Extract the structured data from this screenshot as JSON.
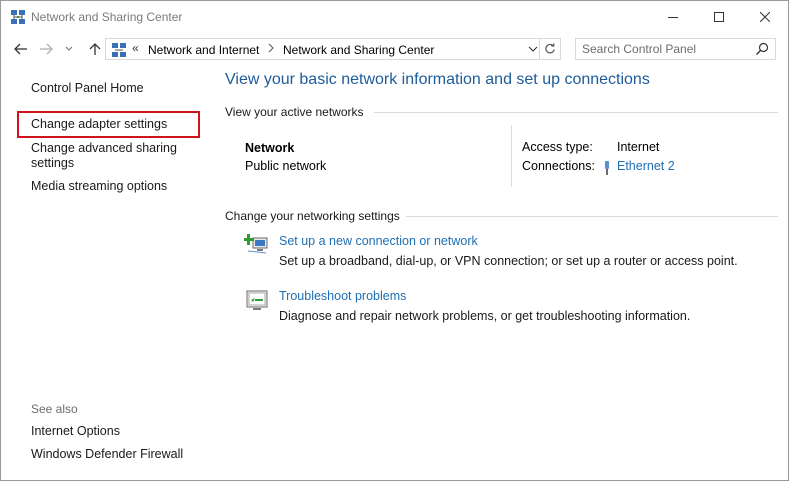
{
  "window": {
    "title": "Network and Sharing Center",
    "icon": "network-sharing-icon"
  },
  "nav": {
    "overflow": "«",
    "breadcrumb": [
      "Network and Internet",
      "Network and Sharing Center"
    ],
    "search_placeholder": "Search Control Panel"
  },
  "sidebar": {
    "home": "Control Panel Home",
    "items": [
      {
        "label": "Change adapter settings",
        "highlighted": true
      },
      {
        "label_line1": "Change advanced sharing",
        "label_line2": "settings"
      },
      {
        "label": "Media streaming options"
      }
    ],
    "see_also": {
      "heading": "See also",
      "items": [
        "Internet Options",
        "Windows Defender Firewall"
      ]
    }
  },
  "main": {
    "title": "View your basic network information and set up connections",
    "active_networks": {
      "heading": "View your active networks",
      "network_name": "Network",
      "network_category": "Public network",
      "access_type_label": "Access type:",
      "access_type_value": "Internet",
      "connections_label": "Connections:",
      "connections_value": "Ethernet 2"
    },
    "settings": {
      "heading": "Change your networking settings",
      "tasks": [
        {
          "icon": "new-connection-icon",
          "link": "Set up a new connection or network",
          "desc": "Set up a broadband, dial-up, or VPN connection; or set up a router or access point."
        },
        {
          "icon": "troubleshoot-icon",
          "link": "Troubleshoot problems",
          "desc": "Diagnose and repair network problems, or get troubleshooting information."
        }
      ]
    }
  },
  "colors": {
    "link": "#1e6fb5",
    "title": "#1e5b9a",
    "highlight": "#d0141c"
  }
}
